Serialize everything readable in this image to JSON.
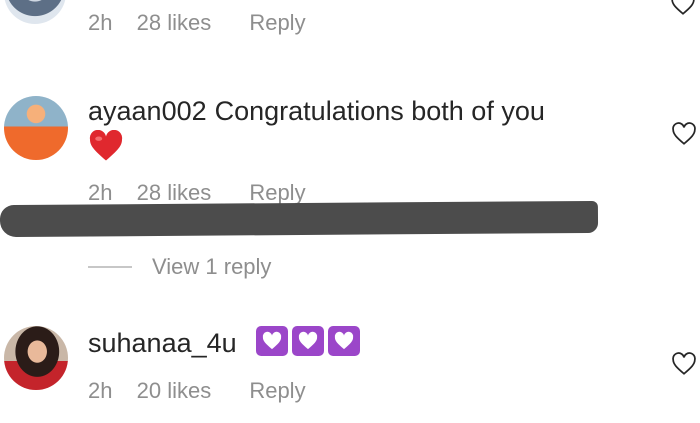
{
  "comments": [
    {
      "user": "",
      "text": "",
      "time": "2h",
      "likes": "28 likes",
      "reply": "Reply"
    },
    {
      "user": "ayaan002",
      "text": "Congratulations both of you",
      "emoji": "red-heart",
      "time": "2h",
      "likes": "28 likes",
      "reply": "Reply",
      "view_replies": "View 1 reply"
    },
    {
      "user": "suhanaa_4u",
      "emoji": [
        "purple-heart",
        "purple-heart",
        "purple-heart"
      ],
      "time": "2h",
      "likes": "20 likes",
      "reply": "Reply"
    }
  ],
  "colors": {
    "text_primary": "#262626",
    "text_secondary": "#8e8e8e",
    "purple_heart": "#9b46c9",
    "red_heart": "#e0282e"
  }
}
